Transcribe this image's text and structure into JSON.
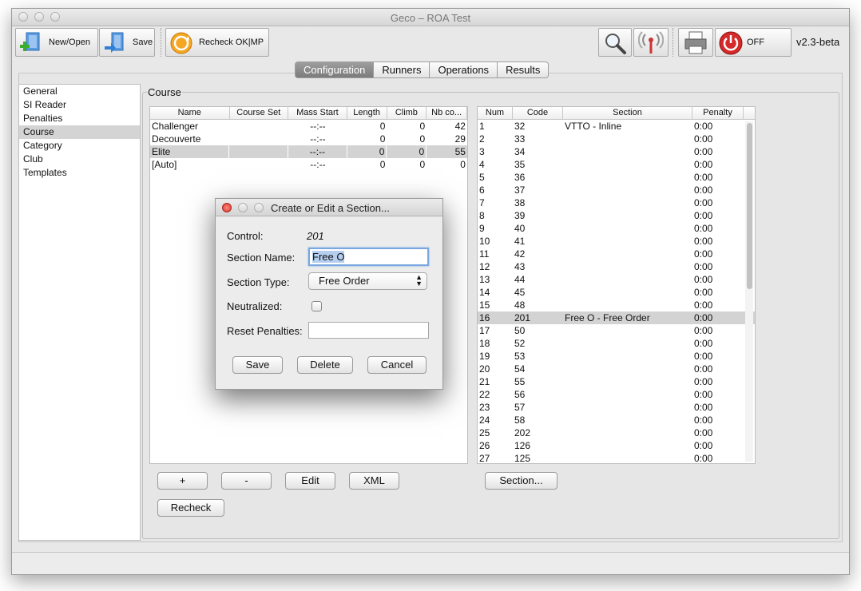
{
  "window": {
    "title": "Geco – ROA Test"
  },
  "toolbar": {
    "new_open": "New/Open",
    "save": "Save",
    "recheck": "Recheck OK|MP",
    "off": "OFF",
    "version": "v2.3-beta"
  },
  "tabs": [
    "Configuration",
    "Runners",
    "Operations",
    "Results"
  ],
  "active_tab": "Configuration",
  "sidebar": {
    "items": [
      "General",
      "SI Reader",
      "Penalties",
      "Course",
      "Category",
      "Club",
      "Templates"
    ],
    "selected": "Course"
  },
  "course": {
    "legend": "Course",
    "columns": [
      "Name",
      "Course Set",
      "Mass Start",
      "Length",
      "Climb",
      "Nb co..."
    ],
    "rows": [
      [
        "Challenger",
        "",
        "--:--",
        "0",
        "0",
        "42"
      ],
      [
        "Decouverte",
        "",
        "--:--",
        "0",
        "0",
        "29"
      ],
      [
        "Elite",
        "",
        "--:--",
        "0",
        "0",
        "55"
      ],
      [
        "[Auto]",
        "",
        "--:--",
        "0",
        "0",
        "0"
      ]
    ],
    "selected_row": 2,
    "buttons": {
      "add": "+",
      "remove": "-",
      "edit": "Edit",
      "xml": "XML",
      "recheck": "Recheck"
    }
  },
  "controls": {
    "columns": [
      "Num",
      "Code",
      "Section",
      "Penalty"
    ],
    "rows": [
      [
        "1",
        "32",
        "VTTO - Inline",
        "0:00"
      ],
      [
        "2",
        "33",
        "",
        "0:00"
      ],
      [
        "3",
        "34",
        "",
        "0:00"
      ],
      [
        "4",
        "35",
        "",
        "0:00"
      ],
      [
        "5",
        "36",
        "",
        "0:00"
      ],
      [
        "6",
        "37",
        "",
        "0:00"
      ],
      [
        "7",
        "38",
        "",
        "0:00"
      ],
      [
        "8",
        "39",
        "",
        "0:00"
      ],
      [
        "9",
        "40",
        "",
        "0:00"
      ],
      [
        "10",
        "41",
        "",
        "0:00"
      ],
      [
        "11",
        "42",
        "",
        "0:00"
      ],
      [
        "12",
        "43",
        "",
        "0:00"
      ],
      [
        "13",
        "44",
        "",
        "0:00"
      ],
      [
        "14",
        "45",
        "",
        "0:00"
      ],
      [
        "15",
        "48",
        "",
        "0:00"
      ],
      [
        "16",
        "201",
        "Free O - Free Order",
        "0:00"
      ],
      [
        "17",
        "50",
        "",
        "0:00"
      ],
      [
        "18",
        "52",
        "",
        "0:00"
      ],
      [
        "19",
        "53",
        "",
        "0:00"
      ],
      [
        "20",
        "54",
        "",
        "0:00"
      ],
      [
        "21",
        "55",
        "",
        "0:00"
      ],
      [
        "22",
        "56",
        "",
        "0:00"
      ],
      [
        "23",
        "57",
        "",
        "0:00"
      ],
      [
        "24",
        "58",
        "",
        "0:00"
      ],
      [
        "25",
        "202",
        "",
        "0:00"
      ],
      [
        "26",
        "126",
        "",
        "0:00"
      ],
      [
        "27",
        "125",
        "",
        "0:00"
      ]
    ],
    "selected_row": 15,
    "section_button": "Section..."
  },
  "dialog": {
    "title": "Create or Edit a Section...",
    "control_label": "Control:",
    "control_value": "201",
    "section_name_label": "Section Name:",
    "section_name_value": "Free O",
    "section_type_label": "Section Type:",
    "section_type_value": "Free Order",
    "neutralized_label": "Neutralized:",
    "neutralized_checked": false,
    "reset_penalties_label": "Reset Penalties:",
    "reset_penalties_value": "",
    "save": "Save",
    "delete": "Delete",
    "cancel": "Cancel"
  },
  "colors": {
    "selection": "#d3d3d3",
    "power_red": "#d42a2a",
    "recheck_orange": "#f5a623",
    "add_green": "#3dae2b",
    "arrow_blue": "#2f7fd6",
    "text_highlight": "#b5cff0"
  }
}
